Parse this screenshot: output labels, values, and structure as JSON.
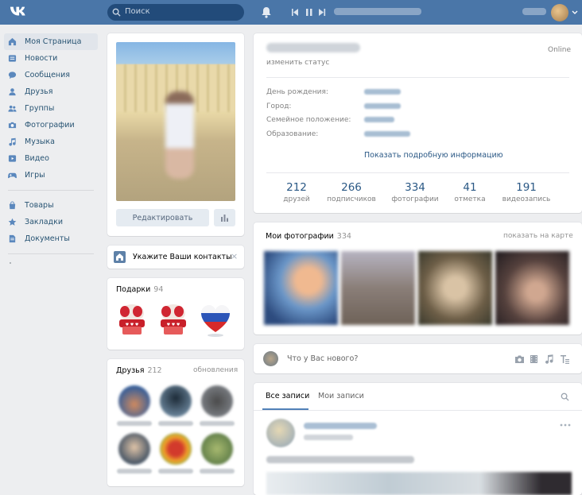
{
  "search": {
    "placeholder": "Поиск"
  },
  "menu": {
    "items": [
      {
        "label": "Моя Страница",
        "icon": "home-icon"
      },
      {
        "label": "Новости",
        "icon": "news-icon"
      },
      {
        "label": "Сообщения",
        "icon": "messages-icon"
      },
      {
        "label": "Друзья",
        "icon": "friends-icon"
      },
      {
        "label": "Группы",
        "icon": "groups-icon"
      },
      {
        "label": "Фотографии",
        "icon": "camera-icon"
      },
      {
        "label": "Музыка",
        "icon": "music-icon"
      },
      {
        "label": "Видео",
        "icon": "video-icon"
      },
      {
        "label": "Игры",
        "icon": "gamepad-icon"
      }
    ],
    "extra_items": [
      {
        "label": "Товары",
        "icon": "bag-icon"
      },
      {
        "label": "Закладки",
        "icon": "star-icon"
      },
      {
        "label": "Документы",
        "icon": "document-icon"
      }
    ]
  },
  "profile_photo": {
    "edit_label": "Редактировать"
  },
  "contact_banner": {
    "text": "Укажите Ваши контакты",
    "close": "×"
  },
  "gifts": {
    "title": "Подарки",
    "count": "94"
  },
  "friends": {
    "title": "Друзья",
    "count": "212",
    "updates_link": "обновления"
  },
  "profile": {
    "status_link": "изменить статус",
    "online": "Online",
    "fields": [
      {
        "label": "День рождения:"
      },
      {
        "label": "Город:"
      },
      {
        "label": "Семейное положение:"
      },
      {
        "label": "Образование:"
      }
    ],
    "more_link": "Показать подробную информацию",
    "counters": [
      {
        "value": "212",
        "label": "друзей"
      },
      {
        "value": "266",
        "label": "подписчиков"
      },
      {
        "value": "334",
        "label": "фотографии"
      },
      {
        "value": "41",
        "label": "отметка"
      },
      {
        "value": "191",
        "label": "видеозапись"
      }
    ]
  },
  "my_photos": {
    "title": "Мои фотографии",
    "count": "334",
    "map_link": "показать на карте"
  },
  "new_post": {
    "placeholder": "Что у Вас нового?"
  },
  "wall": {
    "tab_all": "Все записи",
    "tab_mine": "Мои записи"
  },
  "colors": {
    "header": "#4a76a8",
    "background": "#edeef0",
    "link": "#2a5885",
    "accent": "#5181b8"
  }
}
